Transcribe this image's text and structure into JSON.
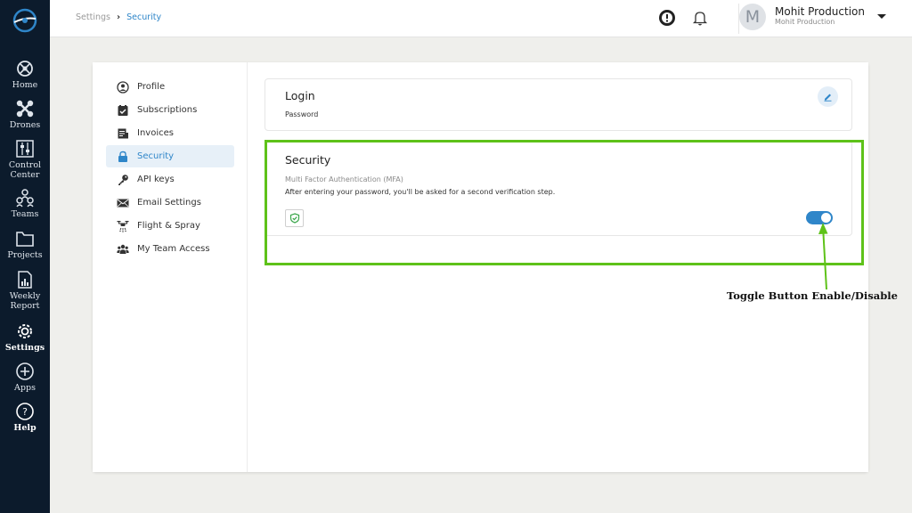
{
  "rail": {
    "items": [
      {
        "label": "Home",
        "icon": "home-icon"
      },
      {
        "label": "Drones",
        "icon": "drone-icon"
      },
      {
        "label": "Control\nCenter",
        "icon": "control-center-icon"
      },
      {
        "label": "Teams",
        "icon": "teams-icon"
      },
      {
        "label": "Projects",
        "icon": "projects-icon"
      },
      {
        "label": "Weekly\nReport",
        "icon": "weekly-report-icon"
      },
      {
        "label": "Settings",
        "icon": "settings-icon"
      },
      {
        "label": "Apps",
        "icon": "apps-icon"
      },
      {
        "label": "Help",
        "icon": "help-icon"
      }
    ]
  },
  "breadcrumb": {
    "parent": "Settings",
    "separator": "›",
    "current": "Security"
  },
  "user": {
    "avatar_letter": "M",
    "name": "Mohit Production",
    "org": "Mohit Production"
  },
  "settings_nav": {
    "items": [
      {
        "label": "Profile",
        "icon": "profile-icon"
      },
      {
        "label": "Subscriptions",
        "icon": "subscriptions-icon"
      },
      {
        "label": "Invoices",
        "icon": "invoices-icon"
      },
      {
        "label": "Security",
        "icon": "lock-icon"
      },
      {
        "label": "API keys",
        "icon": "key-icon"
      },
      {
        "label": "Email Settings",
        "icon": "email-icon"
      },
      {
        "label": "Flight & Spray",
        "icon": "drone-spray-icon"
      },
      {
        "label": "My Team Access",
        "icon": "team-access-icon"
      }
    ],
    "active": "Security"
  },
  "login": {
    "title": "Login",
    "subtitle": "Password"
  },
  "security": {
    "title": "Security",
    "mfa_label": "Multi Factor Authentication (MFA)",
    "description": "After entering your password, you'll be asked for a second verification step.",
    "mfa_enabled": true
  },
  "annotation": {
    "label": "Toggle Button Enable/Disable"
  },
  "colors": {
    "rail_bg": "#0c1b2c",
    "accent": "#2f86c9",
    "highlight": "#5ec219",
    "active_nav_bg": "#e7f0f8"
  }
}
